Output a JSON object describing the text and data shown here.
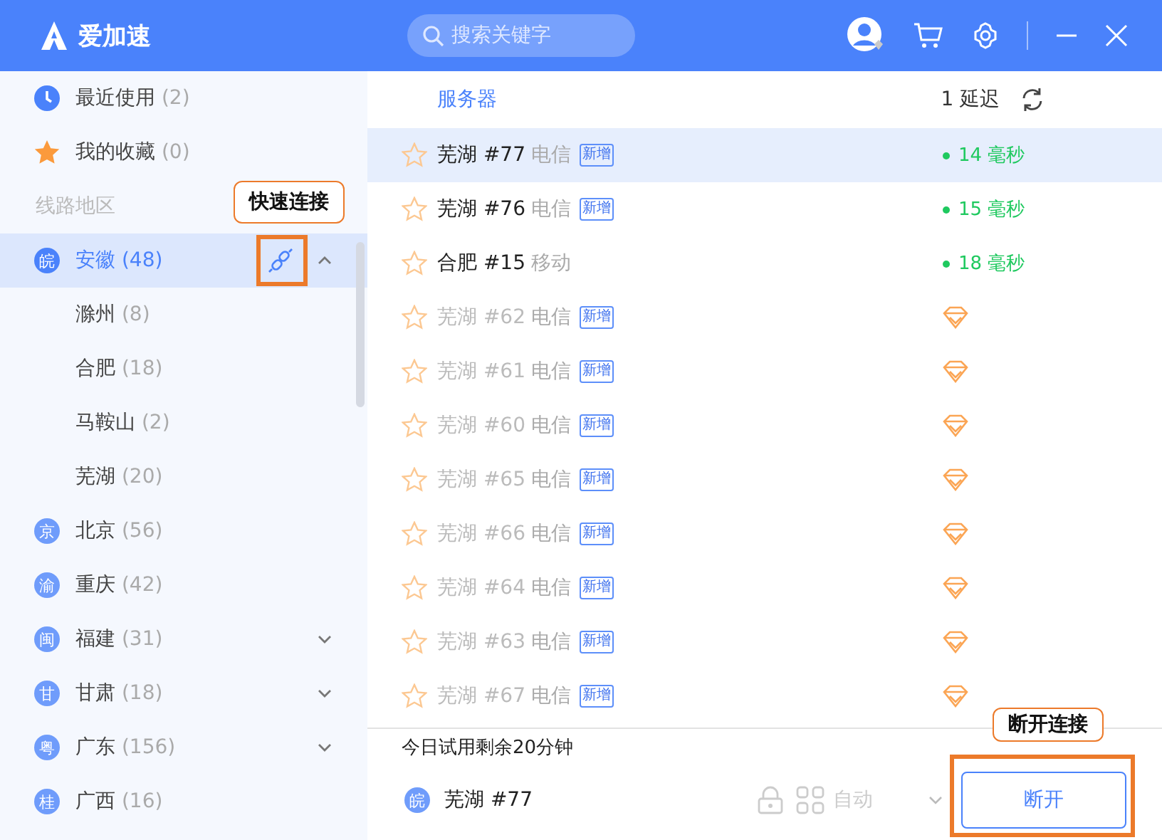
{
  "app": {
    "title": "爱加速"
  },
  "search": {
    "placeholder": "搜索关键字"
  },
  "sidebar": {
    "items": [
      {
        "kind": "recent",
        "label": "最近使用",
        "count": "(2)"
      },
      {
        "kind": "favorite",
        "label": "我的收藏",
        "count": "(0)"
      }
    ],
    "section_label": "线路地区",
    "regions": [
      {
        "badge": "皖",
        "name": "安徽",
        "count": "(48)",
        "selected": true,
        "expanded": true,
        "tooltip": {
          "text": "快速连接",
          "highlight": true
        },
        "children": [
          {
            "name": "滁州",
            "count": "(8)"
          },
          {
            "name": "合肥",
            "count": "(18)"
          },
          {
            "name": "马鞍山",
            "count": "(2)"
          },
          {
            "name": "芜湖",
            "count": "(20)"
          }
        ]
      },
      {
        "badge": "京",
        "name": "北京",
        "count": "(56)",
        "selected": false
      },
      {
        "badge": "渝",
        "name": "重庆",
        "count": "(42)",
        "selected": false
      },
      {
        "badge": "闽",
        "name": "福建",
        "count": "(31)",
        "selected": false,
        "expanded": false
      },
      {
        "badge": "甘",
        "name": "甘肃",
        "count": "(18)",
        "selected": false,
        "expanded": false
      },
      {
        "badge": "粤",
        "name": "广东",
        "count": "(156)",
        "selected": false,
        "expanded": false
      },
      {
        "badge": "桂",
        "name": "广西",
        "count": "(16)",
        "selected": false
      }
    ]
  },
  "servers": {
    "columns": {
      "server": "服务器",
      "latency": "1 延迟"
    },
    "rows": [
      {
        "name": "芜湖 #77",
        "carrier": "电信",
        "tag": "新增",
        "available": true,
        "latency": "14 毫秒",
        "favorite": false,
        "selected": true
      },
      {
        "name": "芜湖 #76",
        "carrier": "电信",
        "tag": "新增",
        "available": true,
        "latency": "15 毫秒",
        "favorite": false,
        "selected": false
      },
      {
        "name": "合肥 #15",
        "carrier": "移动",
        "available": true,
        "latency": "18 毫秒",
        "favorite": false,
        "selected": false
      },
      {
        "name": "芜湖 #62",
        "carrier": "电信",
        "tag": "新增",
        "available": false,
        "favorite": false,
        "selected": false
      },
      {
        "name": "芜湖 #61",
        "carrier": "电信",
        "tag": "新增",
        "available": false,
        "favorite": false,
        "selected": false
      },
      {
        "name": "芜湖 #60",
        "carrier": "电信",
        "tag": "新增",
        "available": false,
        "favorite": false,
        "selected": false
      },
      {
        "name": "芜湖 #65",
        "carrier": "电信",
        "tag": "新增",
        "available": false,
        "favorite": false,
        "selected": false
      },
      {
        "name": "芜湖 #66",
        "carrier": "电信",
        "tag": "新增",
        "available": false,
        "favorite": false,
        "selected": false
      },
      {
        "name": "芜湖 #64",
        "carrier": "电信",
        "tag": "新增",
        "available": false,
        "favorite": false,
        "selected": false
      },
      {
        "name": "芜湖 #63",
        "carrier": "电信",
        "tag": "新增",
        "available": false,
        "favorite": false,
        "selected": false
      },
      {
        "name": "芜湖 #67",
        "carrier": "电信",
        "tag": "新增",
        "available": false,
        "favorite": false,
        "selected": false
      }
    ]
  },
  "connection": {
    "trial_notice": "今日试用剩余20分钟",
    "badge": "皖",
    "server": "芜湖 #77",
    "mode": "自动",
    "button": "断开",
    "tooltip": {
      "text": "断开连接",
      "highlight": true
    }
  }
}
